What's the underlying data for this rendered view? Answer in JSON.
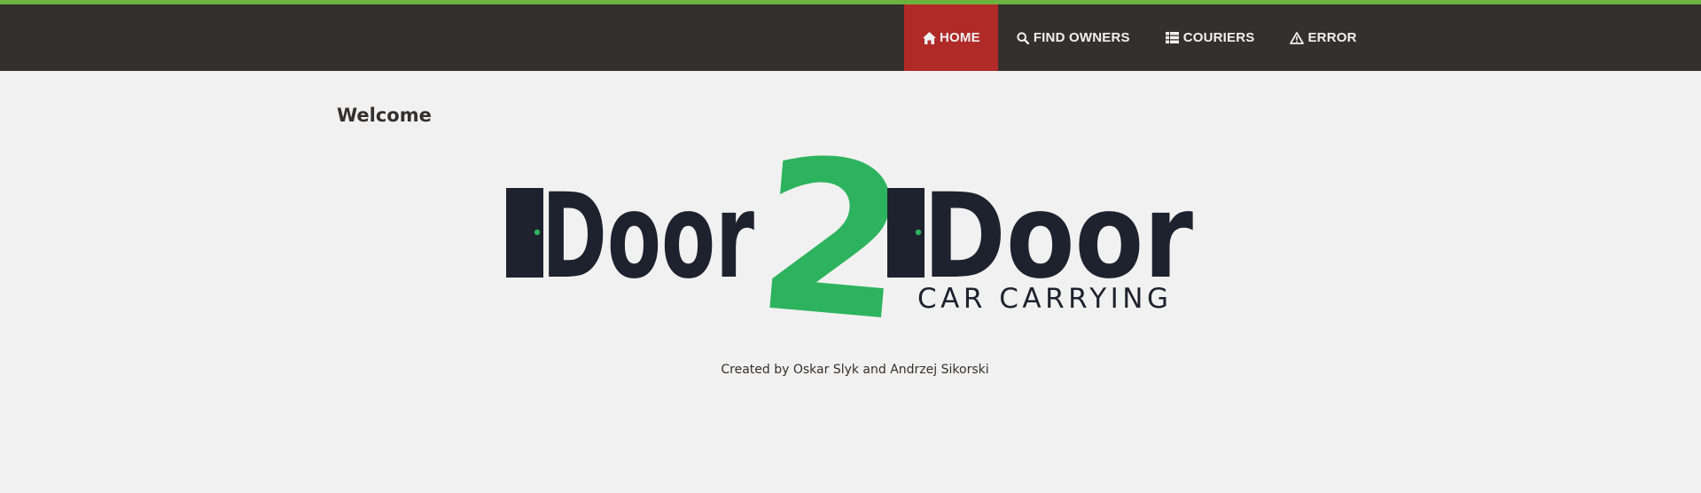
{
  "nav": {
    "items": [
      {
        "label": "HOME",
        "icon": "home-icon",
        "active": true
      },
      {
        "label": "FIND OWNERS",
        "icon": "search-icon",
        "active": false
      },
      {
        "label": "COURIERS",
        "icon": "list-icon",
        "active": false
      },
      {
        "label": "ERROR",
        "icon": "warning-icon",
        "active": false
      }
    ]
  },
  "main": {
    "heading": "Welcome",
    "logo": {
      "word_left": "Door",
      "number": "2",
      "word_right": "Door",
      "tagline": "CAR CARRYING"
    },
    "credits": "Created by Oskar Slyk and Andrzej Sikorski"
  },
  "colors": {
    "topbar_accent": "#6db33f",
    "navbar_bg": "#34302d",
    "active_nav_bg": "#b02a28",
    "logo_dark": "#1e222e",
    "logo_green": "#2db35d",
    "page_bg": "#f1f1f1"
  }
}
